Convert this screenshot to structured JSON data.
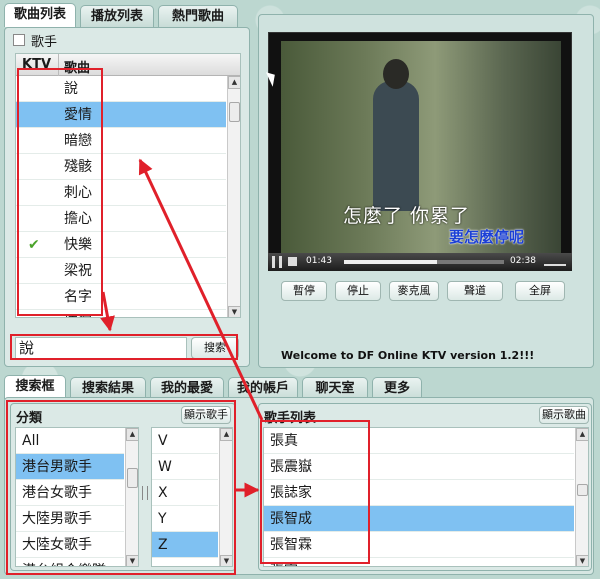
{
  "top_tabs": [
    "歌曲列表",
    "播放列表",
    "熱門歌曲"
  ],
  "singer_checkbox_label": "歌手",
  "song_table": {
    "headers": [
      "KTV",
      "歌曲"
    ],
    "rows": [
      "說",
      "愛情",
      "暗戀",
      "殘骸",
      "刺心",
      "擔心",
      "快樂",
      "梁祝",
      "名字",
      "情深"
    ],
    "selected_index": 1,
    "checked_index": 6
  },
  "search": {
    "value": "說",
    "button": "搜索"
  },
  "video": {
    "lyric_line1": "怎麼了 你累了",
    "lyric_line2": "要怎麼停呢",
    "time_current": "01:43",
    "time_total": "02:38",
    "progress": 0.58
  },
  "player_buttons": [
    "暫停",
    "停止",
    "麥克風",
    "聲道",
    "全屏"
  ],
  "welcome": "Welcome to DF Online KTV version 1.2!!!",
  "bottom_tabs": [
    "搜索框",
    "搜索結果",
    "我的最愛",
    "我的帳戶",
    "聊天室",
    "更多"
  ],
  "category": {
    "title": "分類",
    "show_button": "顯示歌手",
    "items": [
      "All",
      "港台男歌手",
      "港台女歌手",
      "大陸男歌手",
      "大陸女歌手",
      "港台組合樂隊"
    ],
    "selected_index": 1
  },
  "letters": {
    "items": [
      "V",
      "W",
      "X",
      "Y",
      "Z"
    ],
    "selected_index": 4
  },
  "singer_list": {
    "title": "歌手列表",
    "show_button": "顯示歌曲",
    "items": [
      "張真",
      "張震嶽",
      "張誌家",
      "張智成",
      "張智霖",
      "張宇"
    ],
    "selected_index": 3
  }
}
